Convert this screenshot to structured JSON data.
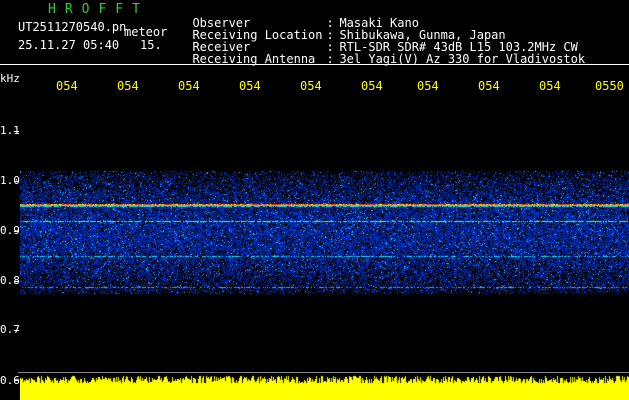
{
  "header": {
    "app_title": "HROFFT",
    "file_name": "UT2511270540.pn",
    "tag_meteor": "meteor",
    "datetime": "25.11.27 05:40",
    "tag_15": "15.",
    "info": [
      {
        "label": "Observer",
        "sep": ":",
        "value": "Masaki Kano"
      },
      {
        "label": "Receiving Location",
        "sep": ":",
        "value": "Shibukawa, Gunma, Japan"
      },
      {
        "label": "Receiver",
        "sep": ":",
        "value": "RTL-SDR SDR# 43dB L15 103.2MHz CW"
      },
      {
        "label": "Receiving Antenna",
        "sep": ":",
        "value": "3el Yagi(V) Az 330 for Vladivostok"
      }
    ]
  },
  "spectrogram": {
    "unit": "kHz",
    "x_ticks": [
      "054",
      "054",
      "054",
      "054",
      "054",
      "054",
      "054",
      "054",
      "054",
      "0550"
    ],
    "y_ticks": [
      "1.1",
      "1.0",
      "0.9",
      "0.8",
      "0.7",
      "0.6"
    ],
    "y_range_khz": [
      0.6,
      1.15
    ],
    "lines_khz": [
      {
        "freq": 0.953,
        "color": "#ff2a00",
        "intensity": "strong"
      },
      {
        "freq": 0.92,
        "color": "#33ffaa",
        "intensity": "medium"
      },
      {
        "freq": 0.85,
        "color": "#22ddff",
        "intensity": "weak"
      },
      {
        "freq": 0.788,
        "color": "#6699ff",
        "intensity": "weak"
      }
    ],
    "noise_band_khz": [
      0.775,
      1.02
    ],
    "colors": {
      "background": "#000000",
      "noise": "#0a3cff",
      "level_bar": "#ffff00"
    }
  }
}
